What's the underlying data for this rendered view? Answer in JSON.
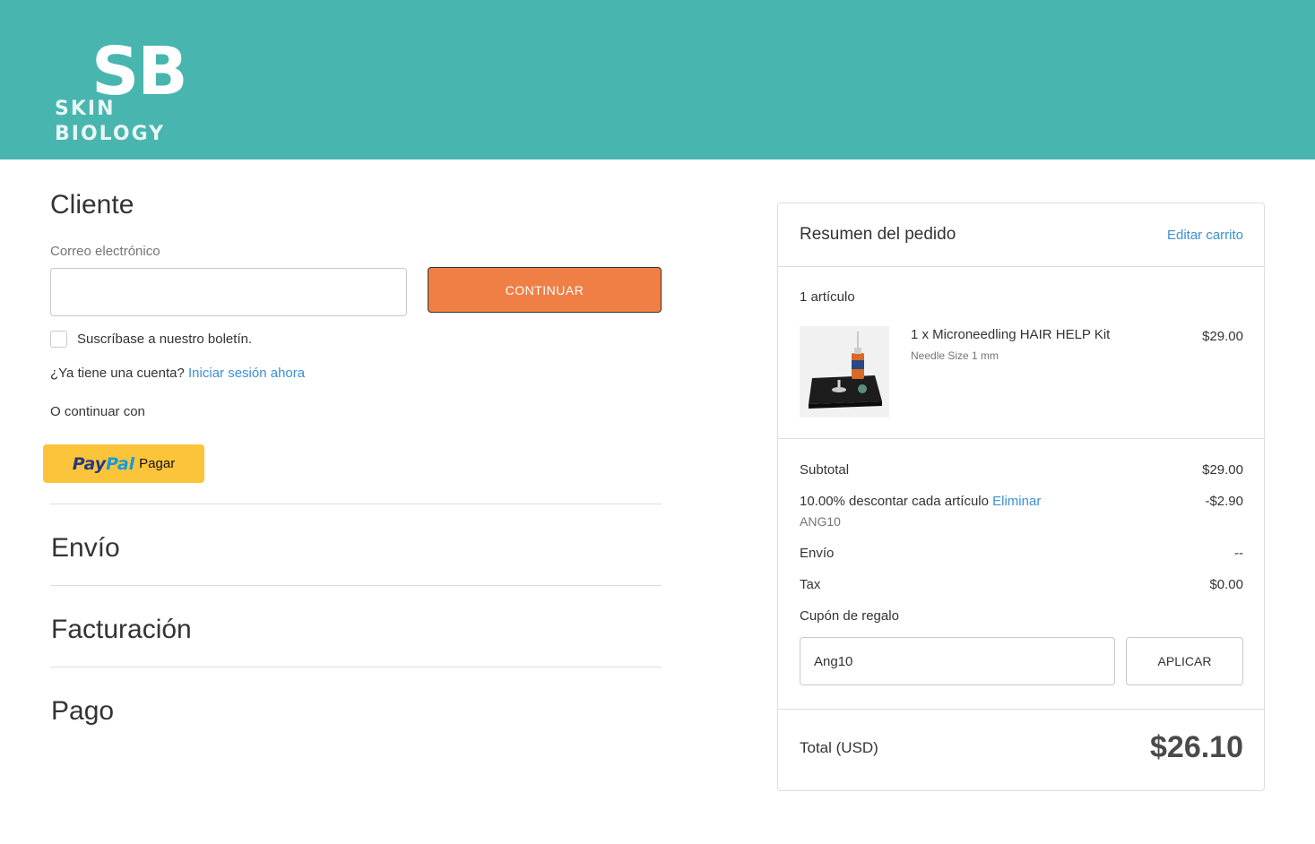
{
  "header": {
    "logo_mark": "SB",
    "logo_text": "SKIN BIOLOGY",
    "background_color": "#48b5ae"
  },
  "customer": {
    "title": "Cliente",
    "email_label": "Correo electrónico",
    "email_value": "",
    "continue_label": "CONTINUAR",
    "newsletter_label": "Suscríbase a nuestro boletín.",
    "newsletter_checked": false,
    "account_question": "¿Ya tiene una cuenta?",
    "signin_link": "Iniciar sesión ahora",
    "or_continue": "O continuar con",
    "paypal_brand_1": "Pay",
    "paypal_brand_2": "Pal",
    "paypal_action": "Pagar",
    "accent_color": "#f07f45"
  },
  "sections": {
    "shipping": "Envío",
    "billing": "Facturación",
    "payment": "Pago"
  },
  "summary": {
    "title": "Resumen del pedido",
    "edit_cart": "Editar carrito",
    "items_count": "1 artículo",
    "item": {
      "name": "1 x Microneedling HAIR HELP Kit",
      "option": "Needle Size 1 mm",
      "price": "$29.00"
    },
    "subtotal_label": "Subtotal",
    "subtotal_value": "$29.00",
    "discount_label": "10.00% descontar cada artículo",
    "discount_remove": "Eliminar",
    "discount_code": "ANG10",
    "discount_value": "-$2.90",
    "shipping_label": "Envío",
    "shipping_value": "--",
    "tax_label": "Tax",
    "tax_value": "$0.00",
    "gift_coupon_label": "Cupón de regalo",
    "coupon_value": "Ang10",
    "apply_label": "APLICAR",
    "total_label": "Total (USD)",
    "total_value": "$26.10",
    "link_color": "#3a91d6"
  }
}
